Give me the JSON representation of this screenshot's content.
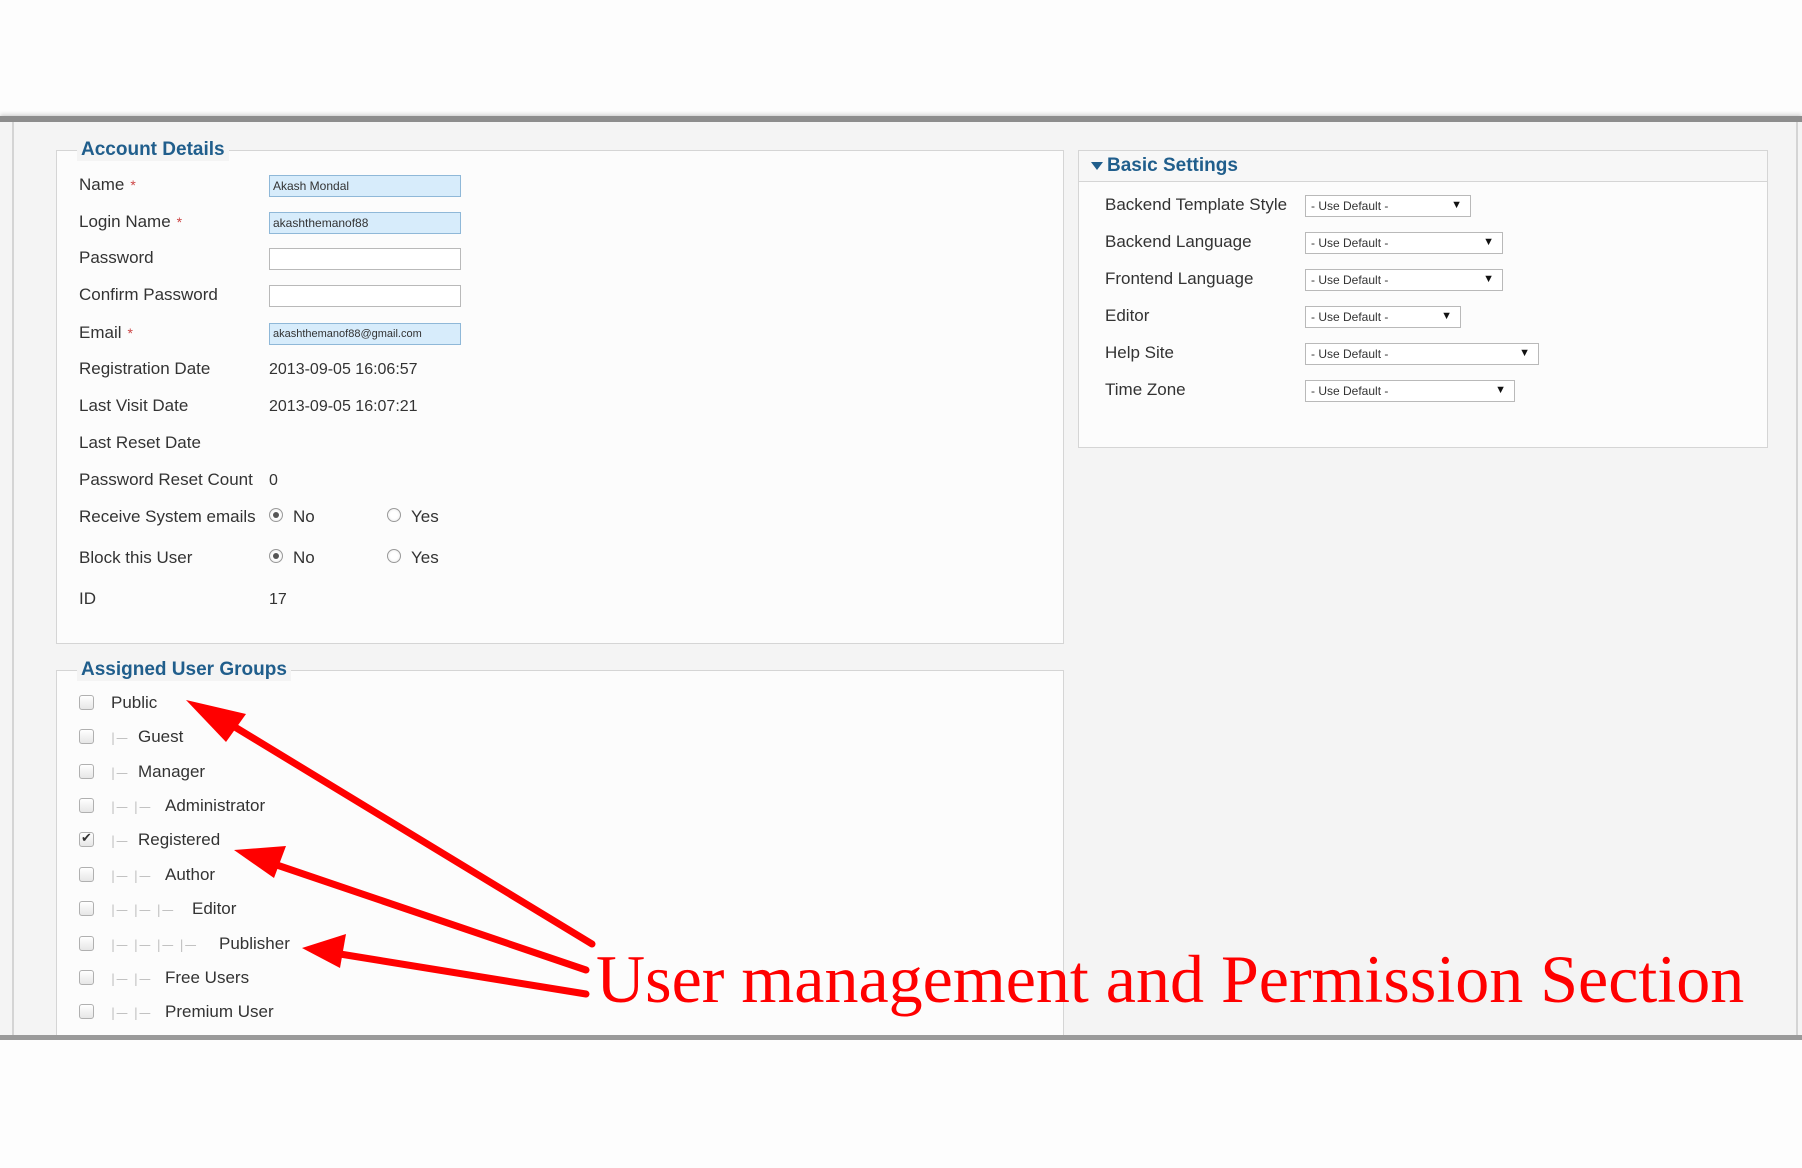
{
  "account_details": {
    "legend": "Account Details",
    "fields": [
      {
        "label": "Name",
        "required": "*",
        "value": "Akash Mondal"
      },
      {
        "label": "Login Name",
        "required": "*",
        "value": "akashthemanof88"
      },
      {
        "label": "Password",
        "value": ""
      },
      {
        "label": "Confirm Password",
        "value": ""
      },
      {
        "label": "Email",
        "required": "*",
        "value": "akashthemanof88@gmail.com"
      }
    ],
    "registration_date_label": "Registration Date",
    "registration_date": "2013-09-05 16:06:57",
    "last_visit_label": "Last Visit Date",
    "last_visit": "2013-09-05 16:07:21",
    "last_reset_label": "Last Reset Date",
    "last_reset": "",
    "reset_count_label": "Password Reset Count",
    "reset_count": "0",
    "receive_emails_label": "Receive System emails",
    "receive_emails_selected": "No",
    "block_user_label": "Block this User",
    "block_user_selected": "No",
    "radio_no": "No",
    "radio_yes": "Yes",
    "id_label": "ID",
    "id_value": "17"
  },
  "user_groups": {
    "legend": "Assigned User Groups",
    "groups": [
      {
        "label": "Public",
        "tree": "",
        "checked": false
      },
      {
        "label": "Guest",
        "tree": "|—",
        "checked": false
      },
      {
        "label": "Manager",
        "tree": "|—",
        "checked": false
      },
      {
        "label": "Administrator",
        "tree": "|— |—",
        "checked": false
      },
      {
        "label": "Registered",
        "tree": "|—",
        "checked": true
      },
      {
        "label": "Author",
        "tree": "|— |—",
        "checked": false
      },
      {
        "label": "Editor",
        "tree": "|— |— |—",
        "checked": false
      },
      {
        "label": "Publisher",
        "tree": "|— |— |— |—",
        "checked": false
      },
      {
        "label": "Free Users",
        "tree": "|— |—",
        "checked": false
      },
      {
        "label": "Premium User",
        "tree": "|— |—",
        "checked": false
      }
    ]
  },
  "basic_settings": {
    "title": "Basic Settings",
    "settings": [
      {
        "label": "Backend Template Style",
        "value": "- Use Default -"
      },
      {
        "label": "Backend Language",
        "value": "- Use Default -"
      },
      {
        "label": "Frontend Language",
        "value": "- Use Default -"
      },
      {
        "label": "Editor",
        "value": "- Use Default -"
      },
      {
        "label": "Help Site",
        "value": "- Use Default -"
      },
      {
        "label": "Time Zone",
        "value": "- Use Default -"
      }
    ]
  },
  "annotation": {
    "text": "User management and Permission Section",
    "color": "#ff0000"
  },
  "colors": {
    "legend": "#205e8c",
    "input_filled": "#d7ecfb"
  }
}
